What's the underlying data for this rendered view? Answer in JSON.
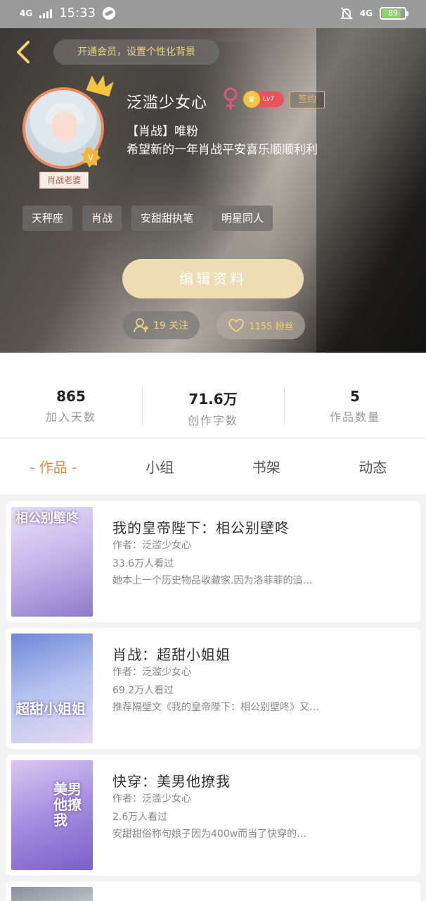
{
  "status": {
    "network": "4G",
    "time": "15:33",
    "network_right": "4G",
    "battery": "89"
  },
  "header": {
    "member_prompt": "开通会员，设置个性化背景",
    "username": "泛滥少女心",
    "level": "Lv7",
    "signed_label": "签约",
    "avatar_tag": "肖战老婆",
    "bio_line1": "【肖战】唯粉",
    "bio_line2": "希望新的一年肖战平安喜乐顺顺利利",
    "tags": [
      "天秤座",
      "肖战",
      "安甜甜执笔",
      "明星同人"
    ],
    "edit_label": "编辑资料",
    "follow_label": "19 关注",
    "fans_label": "1155 粉丝"
  },
  "stats": [
    {
      "num": "865",
      "label": "加入天数"
    },
    {
      "num": "71.6万",
      "label": "创作字数"
    },
    {
      "num": "5",
      "label": "作品数量"
    }
  ],
  "tabs": [
    "- 作品 -",
    "小组",
    "书架",
    "动态"
  ],
  "works": [
    {
      "title": "我的皇帝陛下：相公别壁咚",
      "author": "作者：泛滥少女心",
      "views": "33.6万人看过",
      "desc": "她本上一个历史物品收藏家.因为洛菲菲的追…",
      "cover_text": "相公别壁咚"
    },
    {
      "title": "肖战：超甜小姐姐",
      "author": "作者：泛滥少女心",
      "views": "69.2万人看过",
      "desc": "推荐隔壁文《我的皇帝陛下：相公别壁咚》又…",
      "cover_text": "超甜小姐姐"
    },
    {
      "title": "快穿：美男他撩我",
      "author": "作者：泛滥少女心",
      "views": "2.6万人看过",
      "desc": "安甜甜俗称句娘子因为400w而当了快穿的…",
      "cover_text": "美男他撩我"
    }
  ],
  "colors": {
    "accent": "#e98c4a",
    "gold": "#f3d27a",
    "edit_button": "#efdcb2"
  },
  "icons": [
    "back-arrow-icon",
    "crown-icon",
    "v-badge-icon",
    "female-icon",
    "level-badge-icon",
    "add-person-icon",
    "heart-icon"
  ]
}
